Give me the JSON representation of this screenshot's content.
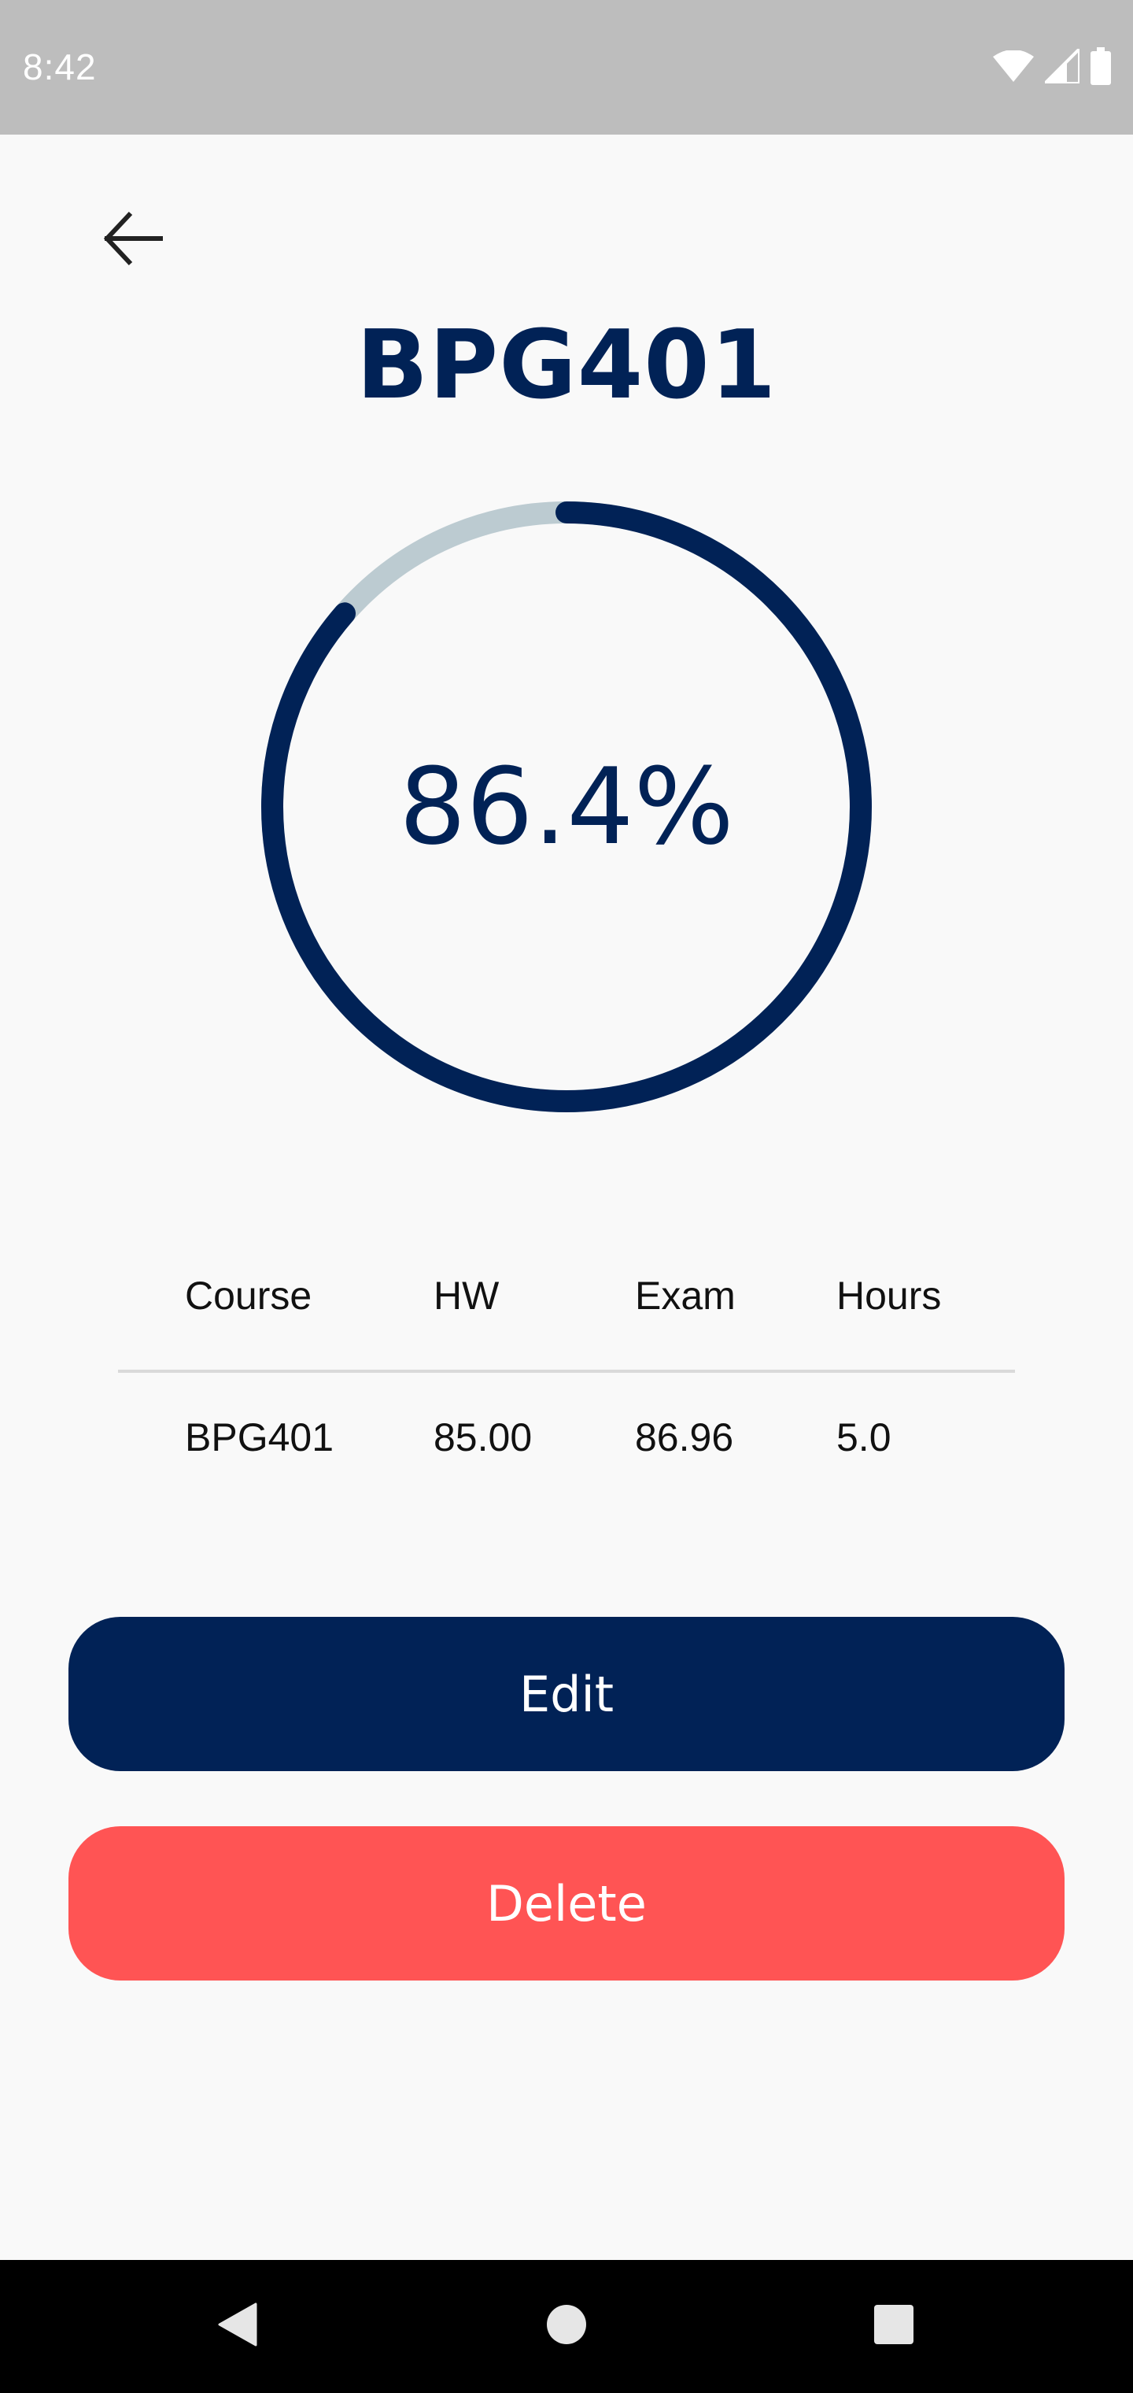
{
  "status_bar": {
    "time": "8:42",
    "icons": [
      "wifi-icon",
      "signal-icon",
      "battery-icon"
    ]
  },
  "header": {
    "back_icon": "arrow-left-icon",
    "title": "BPG401"
  },
  "progress": {
    "label": "86.4%",
    "fraction": 0.864,
    "track_color": "#bccbd1",
    "fill_color": "#012256"
  },
  "table": {
    "headers": [
      "Course",
      "HW",
      "Exam",
      "Hours"
    ],
    "row": [
      "BPG401",
      "85.00",
      "86.96",
      "5.0"
    ]
  },
  "buttons": {
    "edit_label": "Edit",
    "delete_label": "Delete"
  },
  "colors": {
    "primary": "#012256",
    "danger": "#ff5454",
    "background": "#f9f9f9",
    "status_bar": "#bdbdbd"
  },
  "nav_bar": {
    "icons": [
      "nav-back-icon",
      "nav-home-icon",
      "nav-recents-icon"
    ]
  }
}
